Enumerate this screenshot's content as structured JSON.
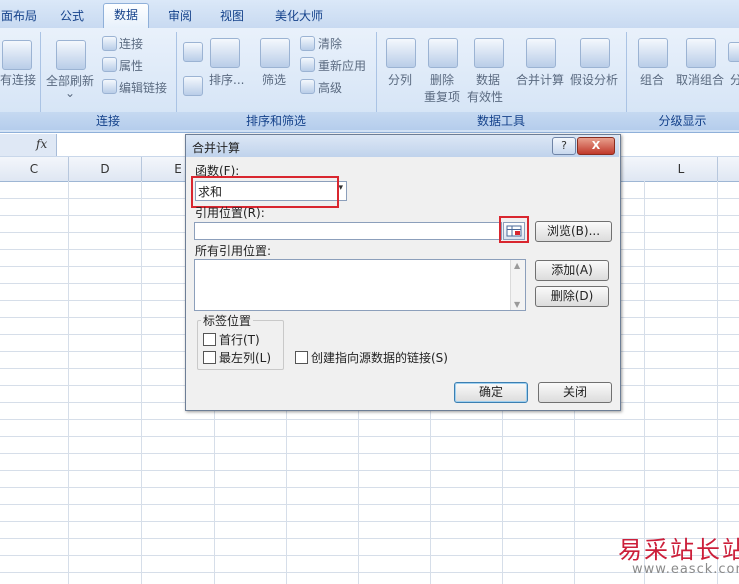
{
  "ribbon": {
    "tabs": [
      {
        "label": "面布局",
        "active": false
      },
      {
        "label": "公式",
        "active": false
      },
      {
        "label": "数据",
        "active": true
      },
      {
        "label": "审阅",
        "active": false
      },
      {
        "label": "视图",
        "active": false
      },
      {
        "label": "美化大师",
        "active": false
      }
    ],
    "groups": {
      "connections": {
        "label": "连接",
        "cut_label": "有连接",
        "refresh_all": "全部刷新",
        "connections_item": "连接",
        "properties_item": "属性",
        "edit_links_item": "编辑链接"
      },
      "sort_filter": {
        "label": "排序和筛选",
        "sort": "排序...",
        "filter": "筛选",
        "clear": "清除",
        "reapply": "重新应用",
        "advanced": "高级"
      },
      "data_tools": {
        "label": "数据工具",
        "text_to_columns": "分列",
        "remove_dup_line1": "删除",
        "remove_dup_line2": "重复项",
        "validation_line1": "数据",
        "validation_line2": "有效性",
        "consolidate": "合并计算",
        "what_if": "假设分析"
      },
      "outline": {
        "label": "分级显示",
        "group": "组合",
        "ungroup": "取消组合",
        "subtotal": "分"
      }
    }
  },
  "formula_bar": {
    "fx_label": "fx"
  },
  "sheet": {
    "columns": [
      "C",
      "D",
      "E",
      "L"
    ]
  },
  "dialog": {
    "title": "合并计算",
    "help_label": "?",
    "close_label": "X",
    "function_label": "函数(F):",
    "function_value": "求和",
    "reference_label": "引用位置(R):",
    "reference_value": "",
    "browse_label": "浏览(B)...",
    "all_references_label": "所有引用位置:",
    "add_label": "添加(A)",
    "delete_label": "删除(D)",
    "label_position_title": "标签位置",
    "top_row_label": "首行(T)",
    "left_column_label": "最左列(L)",
    "create_links_label": "创建指向源数据的链接(S)",
    "ok_label": "确定",
    "cancel_label": "关闭"
  },
  "watermark": {
    "line1": "易采站长站",
    "line2": "www.easck.com"
  },
  "colors": {
    "highlight": "#d9262f",
    "ribbon_text": "#15428b"
  }
}
